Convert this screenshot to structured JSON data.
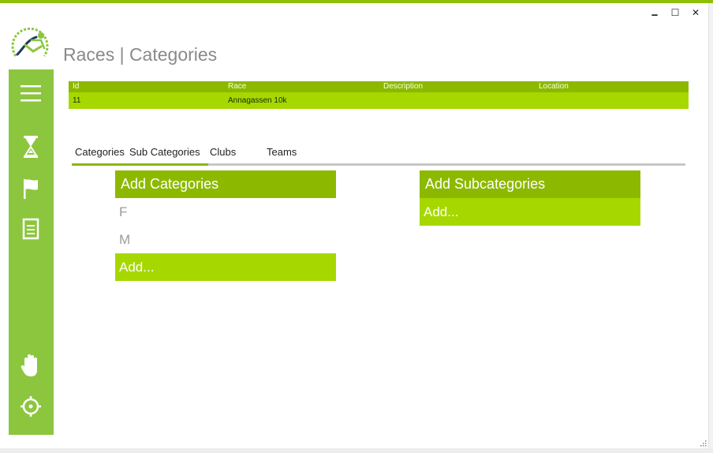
{
  "header": {
    "title": "Races | Categories"
  },
  "window_controls": {
    "minimize": "🗕",
    "maximize": "☐",
    "close": "✕"
  },
  "sidebar": {
    "items": [
      {
        "icon": "menu-icon"
      },
      {
        "icon": "hourglass-icon"
      },
      {
        "icon": "flag-icon"
      },
      {
        "icon": "document-icon"
      },
      {
        "icon": "hand-icon"
      },
      {
        "icon": "settings-icon"
      }
    ]
  },
  "races_table": {
    "columns": [
      "Id",
      "Race",
      "Description",
      "Location"
    ],
    "rows": [
      {
        "id": "11",
        "race": "Annagassen 10k",
        "description": "",
        "location": ""
      }
    ]
  },
  "tabs": [
    {
      "label": "Categories"
    },
    {
      "label": "Sub Categories"
    },
    {
      "label": "Clubs"
    },
    {
      "label": "Teams"
    }
  ],
  "categories_panel": {
    "title": "Add Categories",
    "items": [
      "F",
      "M"
    ],
    "add_label": "Add..."
  },
  "subcategories_panel": {
    "title": "Add Subcategories",
    "add_label": "Add..."
  },
  "colors": {
    "sidebar": "#8cc63f",
    "header_green": "#8cb900",
    "accent_green": "#a6d800"
  }
}
